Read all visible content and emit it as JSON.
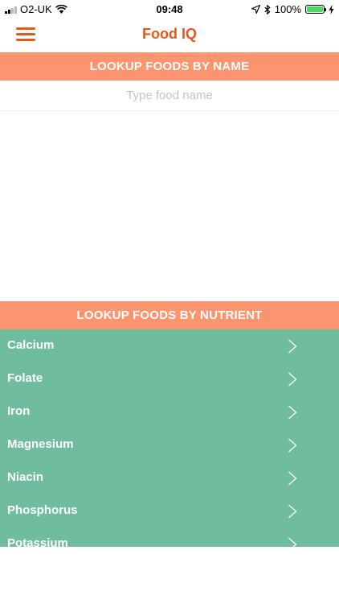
{
  "status_bar": {
    "carrier": "O2-UK",
    "time": "09:48",
    "battery_percent": "100%",
    "battery_level": 1.0
  },
  "nav": {
    "title": "Food IQ"
  },
  "name_section": {
    "header": "LOOKUP FOODS BY NAME",
    "search_placeholder": "Type food name",
    "search_value": ""
  },
  "nutrient_section": {
    "header": "LOOKUP FOODS BY NUTRIENT",
    "items": [
      {
        "label": "Calcium"
      },
      {
        "label": "Folate"
      },
      {
        "label": "Iron"
      },
      {
        "label": "Magnesium"
      },
      {
        "label": "Niacin"
      },
      {
        "label": "Phosphorus"
      },
      {
        "label": "Potassium"
      }
    ]
  },
  "colors": {
    "brand_orange": "#e8561b",
    "header_salmon": "#fb9570",
    "list_green": "#6fbc9f",
    "battery_green": "#4cd964"
  },
  "icons": {
    "menu": "hamburger-menu-icon",
    "chevron": "chevron-right-icon",
    "wifi": "wifi-icon",
    "location": "location-arrow-icon",
    "bluetooth": "bluetooth-icon",
    "charging": "lightning-icon"
  }
}
